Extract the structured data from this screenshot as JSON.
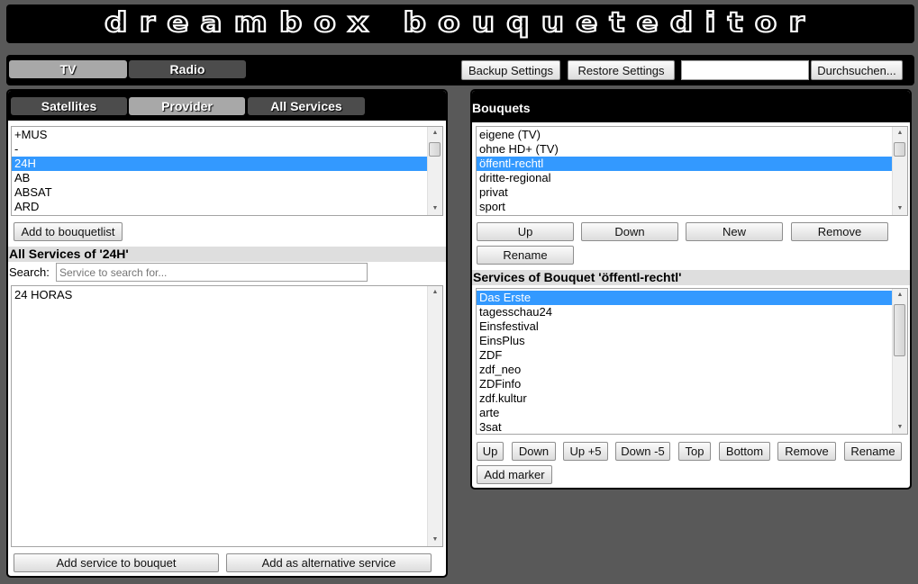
{
  "header": {
    "title": "dreambox bouqueteditor"
  },
  "toolbar": {
    "tabs": [
      {
        "label": "TV",
        "active": true
      },
      {
        "label": "Radio",
        "active": false
      }
    ],
    "backup_label": "Backup Settings",
    "restore_label": "Restore Settings",
    "file_value": "",
    "browse_label": "Durchsuchen..."
  },
  "left": {
    "tabs": [
      {
        "label": "Satellites",
        "active": false
      },
      {
        "label": "Provider",
        "active": true
      },
      {
        "label": "All Services",
        "active": false
      }
    ],
    "providers": [
      "+MUS",
      "-",
      "24H",
      "AB",
      "ABSAT",
      "ARD"
    ],
    "selected_provider": "24H",
    "add_to_bouquetlist": "Add to bouquetlist",
    "services_title": "All Services of '24H'",
    "search_label": "Search:",
    "search_placeholder": "Service to search for...",
    "services": [
      "24 HORAS"
    ],
    "add_service_label": "Add service to bouquet",
    "add_alternative_label": "Add as alternative service"
  },
  "right": {
    "bouquets_title": "Bouquets",
    "bouquets": [
      "eigene (TV)",
      "ohne HD+ (TV)",
      "öffentl-rechtl",
      "dritte-regional",
      "privat",
      "sport"
    ],
    "selected_bouquet": "öffentl-rechtl",
    "bouquet_buttons": {
      "up": "Up",
      "down": "Down",
      "new": "New",
      "remove": "Remove",
      "rename": "Rename"
    },
    "services_title": "Services of Bouquet 'öffentl-rechtl'",
    "services": [
      "Das Erste",
      "tagesschau24",
      "Einsfestival",
      "EinsPlus",
      "ZDF",
      "zdf_neo",
      "ZDFinfo",
      "zdf.kultur",
      "arte",
      "3sat"
    ],
    "selected_service": "Das Erste",
    "service_buttons": {
      "up": "Up",
      "down": "Down",
      "up5": "Up +5",
      "down5": "Down -5",
      "top": "Top",
      "bottom": "Bottom",
      "remove": "Remove",
      "rename": "Rename",
      "add_marker": "Add marker"
    }
  },
  "colors": {
    "selection": "#3399ff",
    "active_tab": "#a8a8a8",
    "inactive_tab": "#4c4c4c",
    "background": "#595959"
  },
  "icons": {
    "scroll_up": "scroll-up-arrow-icon",
    "scroll_down": "scroll-down-arrow-icon"
  }
}
